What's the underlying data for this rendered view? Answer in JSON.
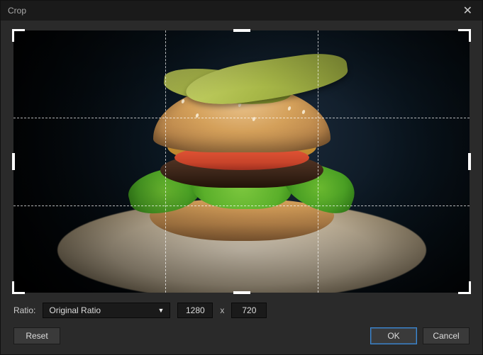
{
  "dialog": {
    "title": "Crop"
  },
  "ratio": {
    "label": "Ratio:",
    "selected": "Original Ratio",
    "separator": "x"
  },
  "dimensions": {
    "width": "1280",
    "height": "720"
  },
  "buttons": {
    "reset": "Reset",
    "ok": "OK",
    "cancel": "Cancel"
  }
}
